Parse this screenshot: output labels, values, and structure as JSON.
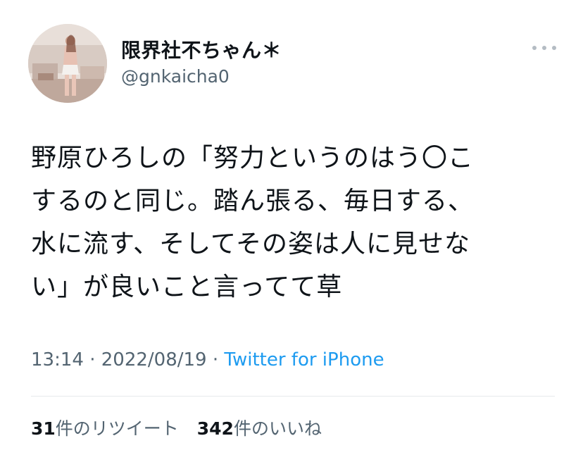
{
  "tweet": {
    "author_name": "限界社不ちゃん＊",
    "author_handle": "@gnkaicha0",
    "text_lines": [
      "野原ひろしの「努力というのはう〇こ",
      "するのと同じ。踏ん張る、毎日する、",
      "水に流す、そしてその姿は人に見せな",
      "い」が良いこと言ってて草"
    ],
    "time": "13:14",
    "separator": " · ",
    "date": "2022/08/19",
    "source": "Twitter for iPhone"
  },
  "stats": {
    "retweets_count": "31",
    "retweets_label": "件のリツイート",
    "likes_count": "342",
    "likes_label": "件のいいね"
  },
  "icons": {
    "more": "more-dots-icon"
  }
}
